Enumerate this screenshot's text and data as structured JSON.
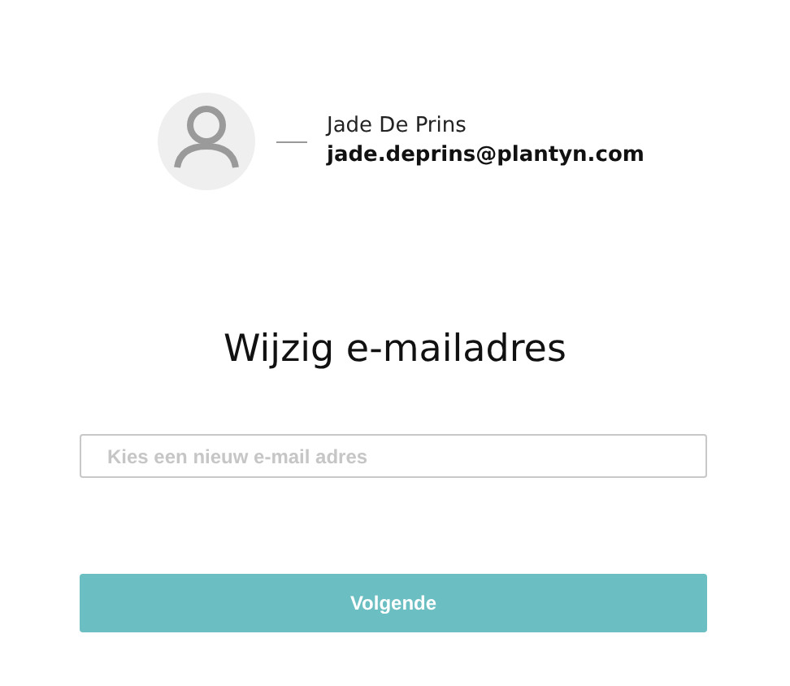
{
  "user": {
    "name": "Jade De Prins",
    "email": "jade.deprins@plantyn.com"
  },
  "title": "Wijzig e-mailadres",
  "email_field": {
    "placeholder": "Kies een nieuw e-mail adres"
  },
  "button": {
    "label": "Volgende"
  }
}
